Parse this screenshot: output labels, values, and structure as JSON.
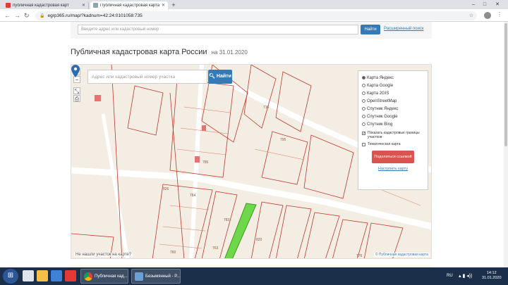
{
  "browser": {
    "tabs": [
      {
        "label": "публичная кадастровая карт",
        "active": false
      },
      {
        "label": "Публичная кадастровая карта",
        "active": true
      }
    ],
    "url": "egrp365.ru/map/?kadnum=42:24:0101058:735"
  },
  "site": {
    "search_placeholder": "Введите адрес или кадастровый номер",
    "find_button": "Найти",
    "advanced_search": "Расширенный поиск"
  },
  "page": {
    "title": "Публичная кадастровая карта России",
    "date": "на 31.01.2020"
  },
  "map": {
    "search_placeholder": "Адрес или кадастровый номер участка",
    "search_button": "Найти",
    "zoom_in": "+",
    "zoom_out": "−",
    "layers": [
      {
        "label": "Карта Яндекс",
        "selected": true
      },
      {
        "label": "Карта Google",
        "selected": false
      },
      {
        "label": "Карта 2GIS",
        "selected": false
      },
      {
        "label": "OpenStreetMap",
        "selected": false
      },
      {
        "label": "Спутник Яндекс",
        "selected": false
      },
      {
        "label": "Спутник Google",
        "selected": false
      },
      {
        "label": "Спутник Bing",
        "selected": false
      }
    ],
    "show_borders_label": "Показать кадастровые границы участков",
    "show_borders_checked": true,
    "thematic_label": "Тематическая карта",
    "thematic_checked": false,
    "share_button": "Поделиться ссылкой",
    "configure_link": "Настроить карту",
    "footnote": "Не нашли участок на карте?",
    "copyright": "© Публичная кадастровая карта",
    "parcel_labels": [
      "716",
      "785",
      "784",
      "826",
      "783",
      "795",
      "760",
      "763",
      "820",
      "776"
    ]
  },
  "taskbar": {
    "apps": [
      {
        "label": "Публичная кад..."
      },
      {
        "label": "Безымянный - Р..."
      }
    ],
    "lang": "RU",
    "time": "14:12",
    "date": "31.01.2020"
  },
  "colors": {
    "parcel_fill": "#6fd84a",
    "primary": "#337ab7",
    "danger": "#d9534f",
    "boundary": "#c0392b"
  }
}
